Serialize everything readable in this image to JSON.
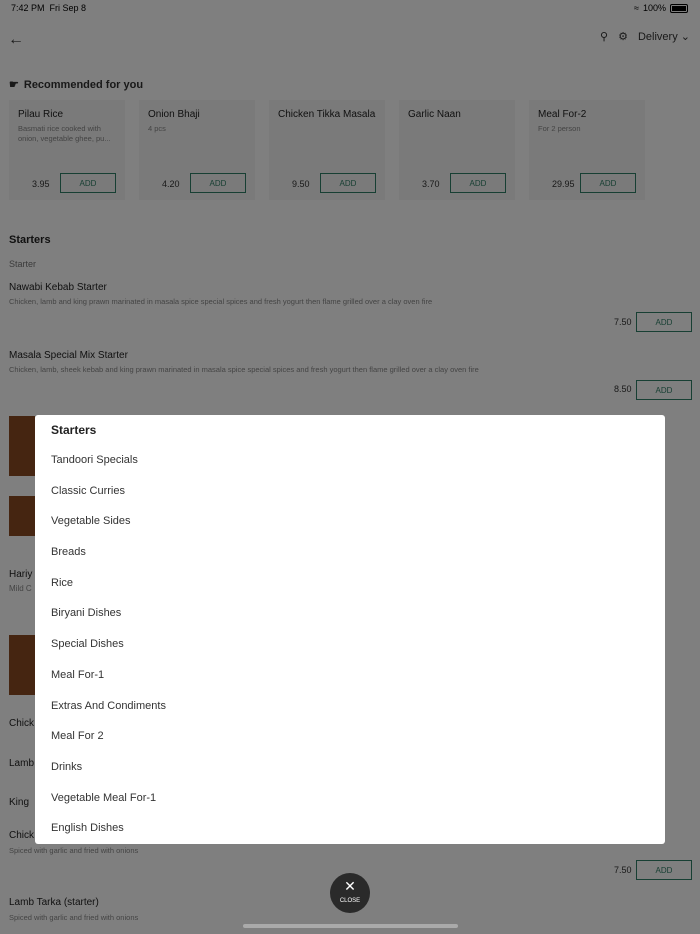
{
  "status": {
    "time": "7:42 PM",
    "date": "Fri Sep 8",
    "battery": "100%"
  },
  "header": {
    "mode": "Delivery"
  },
  "recommended": {
    "title": "Recommended for you",
    "cards": [
      {
        "name": "Pilau Rice",
        "desc": "Basmati rice cooked with onion, vegetable ghee, pu...",
        "price": "3.95",
        "add": "ADD"
      },
      {
        "name": "Onion Bhaji",
        "desc": "4 pcs",
        "price": "4.20",
        "add": "ADD"
      },
      {
        "name": "Chicken Tikka Masala",
        "desc": "",
        "price": "9.50",
        "add": "ADD"
      },
      {
        "name": "Garlic Naan",
        "desc": "",
        "price": "3.70",
        "add": "ADD"
      },
      {
        "name": "Meal For-2",
        "desc": "For 2 person",
        "price": "29.95",
        "add": "ADD"
      }
    ]
  },
  "menu": {
    "category": "Starters",
    "subcategory": "Starter",
    "items": [
      {
        "name": "Nawabi Kebab Starter",
        "desc": "Chicken, lamb and king prawn marinated in masala spice special spices and fresh yogurt then flame grilled over a clay oven fire",
        "price": "7.50",
        "add": "ADD"
      },
      {
        "name": "Masala Special Mix Starter",
        "desc": "Chicken, lamb, sheek kebab and king prawn marinated in masala spice special spices and fresh yogurt then flame grilled over a clay oven fire",
        "price": "8.50",
        "add": "ADD"
      }
    ],
    "partial": {
      "hariya": "Hariy",
      "mild": "Mild C",
      "chick1": "Chick",
      "lamb": "Lamb",
      "king": "King",
      "chick2": "Chick",
      "chick2_desc": "Spiced with garlic and fried with onions",
      "chick2_price": "7.50",
      "add": "ADD",
      "lamb_tarka": "Lamb Tarka (starter)",
      "lamb_tarka_desc": "Spiced with garlic and fried with onions"
    }
  },
  "modal": {
    "title": "Starters",
    "items": [
      "Tandoori Specials",
      "Classic Curries",
      "Vegetable Sides",
      "Breads",
      "Rice",
      "Biryani Dishes",
      "Special Dishes",
      "Meal For-1",
      "Extras And Condiments",
      "Meal For 2",
      "Drinks",
      "Vegetable Meal For-1",
      "English Dishes"
    ],
    "close": "CLOSE"
  }
}
